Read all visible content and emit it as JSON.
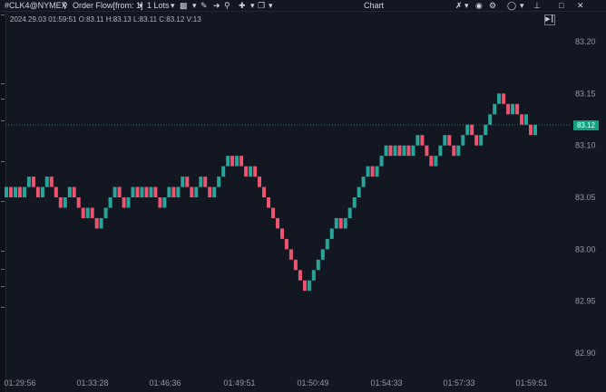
{
  "toolbar": {
    "symbol": "#CLK4@NYMEX",
    "indicator": "Order Flow[from: 1]",
    "lots": "1 Lots",
    "title": "Chart",
    "icons": [
      "search-icon",
      "dropdown-icon",
      "template-icon",
      "pencil-icon",
      "arrow-icon",
      "zoom-icon",
      "crosshair-icon",
      "layout-icon",
      "compare-icon",
      "camera-icon",
      "settings-icon",
      "circle-icon",
      "pin-icon",
      "maximize-icon",
      "close-icon"
    ]
  },
  "legend": {
    "ohlc": "2024.29.03 01:59:51 O:83.11 H:83.13 L:83.11 C:83.12 V:13"
  },
  "price_axis": {
    "last_price": "83.12",
    "last_price_color": "#12a283"
  },
  "colors": {
    "background": "#131722",
    "up": "#26a69a",
    "down": "#ef5370"
  },
  "chart_data": {
    "type": "candlestick",
    "symbol": "#CLK4@NYMEX",
    "ylim": [
      82.88,
      83.22
    ],
    "yticks": [
      "83.20",
      "83.15",
      "83.10",
      "83.05",
      "83.00",
      "82.95",
      "82.90"
    ],
    "xticks": [
      "01:29:56",
      "01:33:28",
      "01:46:36",
      "01:49:51",
      "01:50:49",
      "01:54:33",
      "01:57:33",
      "01:59:51"
    ],
    "brick_size": 0.01,
    "candles": [
      {
        "o": 83.05,
        "c": 83.06
      },
      {
        "o": 83.06,
        "c": 83.05
      },
      {
        "o": 83.05,
        "c": 83.06
      },
      {
        "o": 83.06,
        "c": 83.05
      },
      {
        "o": 83.05,
        "c": 83.06
      },
      {
        "o": 83.06,
        "c": 83.07
      },
      {
        "o": 83.07,
        "c": 83.06
      },
      {
        "o": 83.06,
        "c": 83.05
      },
      {
        "o": 83.05,
        "c": 83.06
      },
      {
        "o": 83.06,
        "c": 83.07
      },
      {
        "o": 83.07,
        "c": 83.06
      },
      {
        "o": 83.06,
        "c": 83.05
      },
      {
        "o": 83.05,
        "c": 83.04
      },
      {
        "o": 83.04,
        "c": 83.05
      },
      {
        "o": 83.05,
        "c": 83.06
      },
      {
        "o": 83.06,
        "c": 83.05
      },
      {
        "o": 83.05,
        "c": 83.04
      },
      {
        "o": 83.04,
        "c": 83.03
      },
      {
        "o": 83.03,
        "c": 83.04
      },
      {
        "o": 83.04,
        "c": 83.03
      },
      {
        "o": 83.03,
        "c": 83.02
      },
      {
        "o": 83.02,
        "c": 83.03
      },
      {
        "o": 83.03,
        "c": 83.04
      },
      {
        "o": 83.04,
        "c": 83.05
      },
      {
        "o": 83.05,
        "c": 83.06
      },
      {
        "o": 83.06,
        "c": 83.05
      },
      {
        "o": 83.05,
        "c": 83.04
      },
      {
        "o": 83.04,
        "c": 83.05
      },
      {
        "o": 83.05,
        "c": 83.06
      },
      {
        "o": 83.06,
        "c": 83.05
      },
      {
        "o": 83.05,
        "c": 83.06
      },
      {
        "o": 83.06,
        "c": 83.05
      },
      {
        "o": 83.05,
        "c": 83.06
      },
      {
        "o": 83.06,
        "c": 83.05
      },
      {
        "o": 83.05,
        "c": 83.04
      },
      {
        "o": 83.04,
        "c": 83.05
      },
      {
        "o": 83.05,
        "c": 83.06
      },
      {
        "o": 83.06,
        "c": 83.05
      },
      {
        "o": 83.05,
        "c": 83.06
      },
      {
        "o": 83.06,
        "c": 83.07
      },
      {
        "o": 83.07,
        "c": 83.06
      },
      {
        "o": 83.06,
        "c": 83.05
      },
      {
        "o": 83.05,
        "c": 83.06
      },
      {
        "o": 83.06,
        "c": 83.07
      },
      {
        "o": 83.07,
        "c": 83.06
      },
      {
        "o": 83.06,
        "c": 83.05
      },
      {
        "o": 83.05,
        "c": 83.06
      },
      {
        "o": 83.06,
        "c": 83.07
      },
      {
        "o": 83.07,
        "c": 83.08
      },
      {
        "o": 83.08,
        "c": 83.09
      },
      {
        "o": 83.09,
        "c": 83.08
      },
      {
        "o": 83.08,
        "c": 83.09
      },
      {
        "o": 83.09,
        "c": 83.08
      },
      {
        "o": 83.08,
        "c": 83.07
      },
      {
        "o": 83.07,
        "c": 83.08
      },
      {
        "o": 83.08,
        "c": 83.07
      },
      {
        "o": 83.07,
        "c": 83.06
      },
      {
        "o": 83.06,
        "c": 83.05
      },
      {
        "o": 83.05,
        "c": 83.04
      },
      {
        "o": 83.04,
        "c": 83.03
      },
      {
        "o": 83.03,
        "c": 83.02
      },
      {
        "o": 83.02,
        "c": 83.01
      },
      {
        "o": 83.01,
        "c": 83.0
      },
      {
        "o": 83.0,
        "c": 82.99
      },
      {
        "o": 82.99,
        "c": 82.98
      },
      {
        "o": 82.98,
        "c": 82.97
      },
      {
        "o": 82.97,
        "c": 82.96
      },
      {
        "o": 82.96,
        "c": 82.97
      },
      {
        "o": 82.97,
        "c": 82.98
      },
      {
        "o": 82.98,
        "c": 82.99
      },
      {
        "o": 82.99,
        "c": 83.0
      },
      {
        "o": 83.0,
        "c": 83.01
      },
      {
        "o": 83.01,
        "c": 83.02
      },
      {
        "o": 83.02,
        "c": 83.03
      },
      {
        "o": 83.03,
        "c": 83.02
      },
      {
        "o": 83.02,
        "c": 83.03
      },
      {
        "o": 83.03,
        "c": 83.04
      },
      {
        "o": 83.04,
        "c": 83.05
      },
      {
        "o": 83.05,
        "c": 83.06
      },
      {
        "o": 83.06,
        "c": 83.07
      },
      {
        "o": 83.07,
        "c": 83.08
      },
      {
        "o": 83.08,
        "c": 83.07
      },
      {
        "o": 83.07,
        "c": 83.08
      },
      {
        "o": 83.08,
        "c": 83.09
      },
      {
        "o": 83.09,
        "c": 83.1
      },
      {
        "o": 83.1,
        "c": 83.09
      },
      {
        "o": 83.09,
        "c": 83.1
      },
      {
        "o": 83.1,
        "c": 83.09
      },
      {
        "o": 83.09,
        "c": 83.1
      },
      {
        "o": 83.1,
        "c": 83.09
      },
      {
        "o": 83.09,
        "c": 83.1
      },
      {
        "o": 83.1,
        "c": 83.11
      },
      {
        "o": 83.11,
        "c": 83.1
      },
      {
        "o": 83.1,
        "c": 83.09
      },
      {
        "o": 83.09,
        "c": 83.08
      },
      {
        "o": 83.08,
        "c": 83.09
      },
      {
        "o": 83.09,
        "c": 83.1
      },
      {
        "o": 83.1,
        "c": 83.11
      },
      {
        "o": 83.11,
        "c": 83.1
      },
      {
        "o": 83.1,
        "c": 83.09
      },
      {
        "o": 83.09,
        "c": 83.1
      },
      {
        "o": 83.1,
        "c": 83.11
      },
      {
        "o": 83.11,
        "c": 83.12
      },
      {
        "o": 83.12,
        "c": 83.11
      },
      {
        "o": 83.11,
        "c": 83.1
      },
      {
        "o": 83.1,
        "c": 83.11
      },
      {
        "o": 83.11,
        "c": 83.12
      },
      {
        "o": 83.12,
        "c": 83.13
      },
      {
        "o": 83.13,
        "c": 83.14
      },
      {
        "o": 83.14,
        "c": 83.15
      },
      {
        "o": 83.15,
        "c": 83.14
      },
      {
        "o": 83.14,
        "c": 83.13
      },
      {
        "o": 83.13,
        "c": 83.14
      },
      {
        "o": 83.14,
        "c": 83.13
      },
      {
        "o": 83.13,
        "c": 83.12
      },
      {
        "o": 83.12,
        "c": 83.13
      },
      {
        "o": 83.12,
        "c": 83.11
      },
      {
        "o": 83.11,
        "c": 83.12
      }
    ]
  }
}
